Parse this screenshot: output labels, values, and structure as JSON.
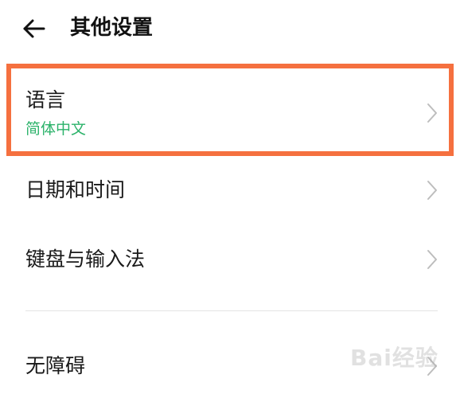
{
  "header": {
    "title": "其他设置",
    "back_icon": "arrow-left-icon"
  },
  "items": [
    {
      "label": "语言",
      "value": "简体中文"
    },
    {
      "label": "日期和时间"
    },
    {
      "label": "键盘与输入法"
    },
    {
      "label": "无障碍"
    }
  ],
  "colors": {
    "accent": "#2db36b",
    "highlight_border": "#f5703f",
    "divider": "#e4e4e4"
  },
  "watermark": "Bai经验"
}
